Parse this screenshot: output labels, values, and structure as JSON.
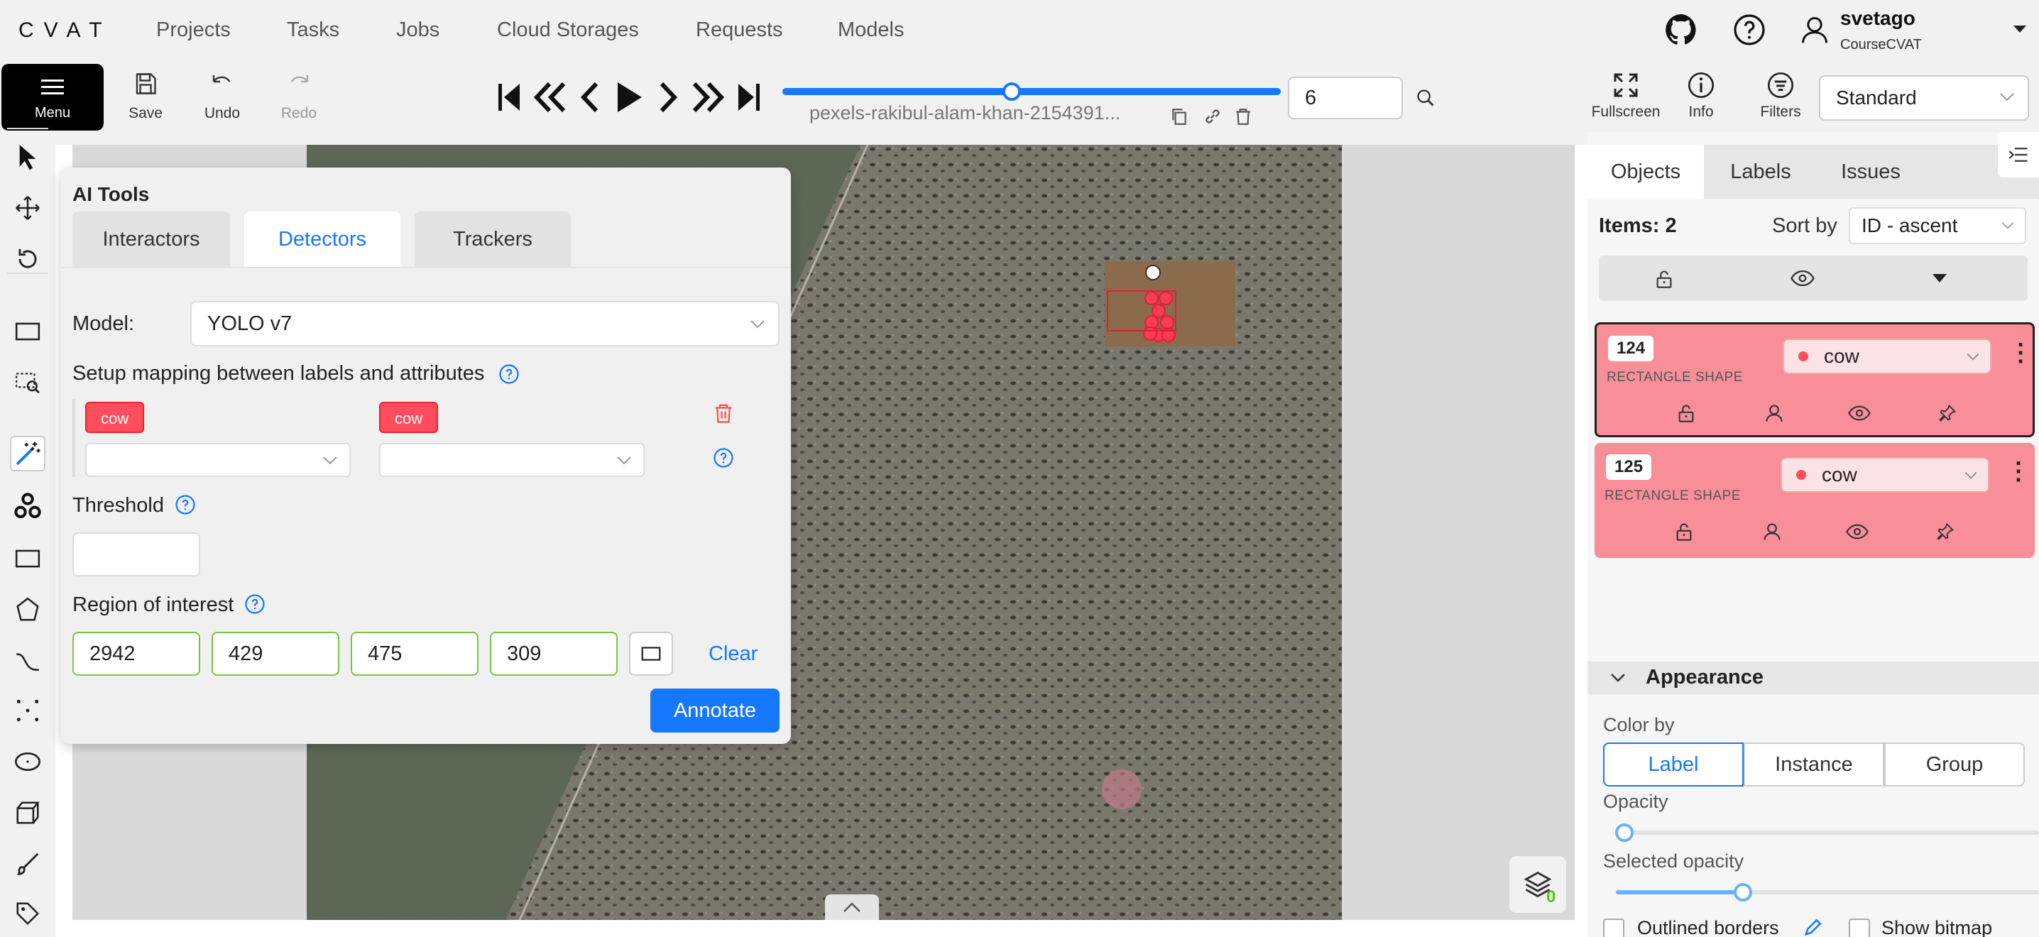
{
  "header": {
    "logo": "CVAT",
    "nav": [
      "Projects",
      "Tasks",
      "Jobs",
      "Cloud Storages",
      "Requests",
      "Models"
    ],
    "icons": [
      "github-icon",
      "help-icon",
      "user-icon"
    ],
    "user": {
      "name": "svetago",
      "org": "CourseCVAT"
    }
  },
  "toolbar": {
    "menu_label": "Menu",
    "save_label": "Save",
    "undo_label": "Undo",
    "redo_label": "Redo",
    "filename": "pexels-rakibul-alam-khan-2154391...",
    "frame": "6",
    "frame_progress": 0.46,
    "fullscreen_label": "Fullscreen",
    "info_label": "Info",
    "filters_label": "Filters",
    "workspace": "Standard"
  },
  "ai_tools": {
    "title": "AI Tools",
    "tabs": [
      "Interactors",
      "Detectors",
      "Trackers"
    ],
    "active_tab": "Detectors",
    "model_label": "Model:",
    "model_value": "YOLO v7",
    "mapping_label": "Setup mapping between labels and attributes",
    "mapping": {
      "model_label": "cow",
      "task_label": "cow"
    },
    "threshold_label": "Threshold",
    "threshold_value": "",
    "roi_label": "Region of interest",
    "roi_values": [
      "2942",
      "429",
      "475",
      "309"
    ],
    "clear_label": "Clear",
    "annotate_label": "Annotate"
  },
  "sidebar": {
    "tabs": [
      "Objects",
      "Labels",
      "Issues"
    ],
    "active_tab": "Objects",
    "items_label": "Items: 2",
    "sort_label": "Sort by",
    "sort_value": "ID - ascent",
    "objects": [
      {
        "id": "124",
        "type": "RECTANGLE SHAPE",
        "label": "cow",
        "selected": true
      },
      {
        "id": "125",
        "type": "RECTANGLE SHAPE",
        "label": "cow",
        "selected": false
      }
    ],
    "appearance": {
      "title": "Appearance",
      "color_by_label": "Color by",
      "color_by_options": [
        "Label",
        "Instance",
        "Group"
      ],
      "color_by_selected": "Label",
      "opacity_label": "Opacity",
      "opacity_value": 0.02,
      "selected_opacity_label": "Selected opacity",
      "selected_opacity_value": 0.3,
      "outlined_borders_label": "Outlined borders",
      "show_bitmap_label": "Show bitmap"
    }
  },
  "colors": {
    "accent": "#1677ff",
    "label_cow": "#ff4d5e",
    "card_bg": "#f78e98",
    "roi_border": "#7cc242"
  },
  "layers_count": "0"
}
